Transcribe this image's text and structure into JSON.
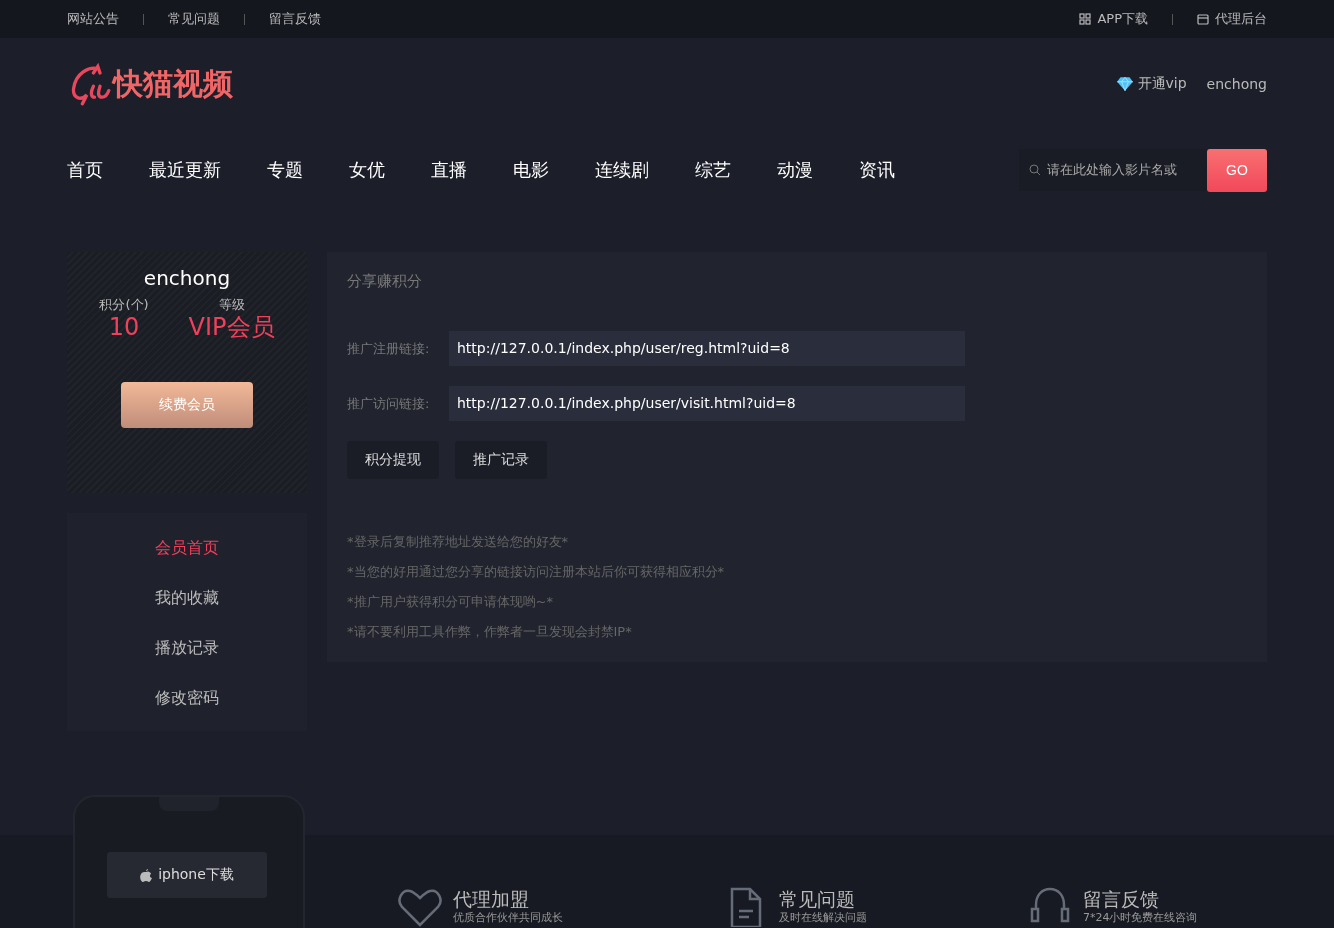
{
  "top_links": [
    "网站公告",
    "常见问题",
    "留言反馈"
  ],
  "top_right": [
    {
      "kind": "app",
      "label": "APP下载"
    },
    {
      "kind": "agent",
      "label": "代理后台"
    }
  ],
  "logo": {
    "text": "快猫视频"
  },
  "user_links": [
    {
      "kind": "vip",
      "label": "开通vip"
    },
    {
      "kind": "user",
      "label": "enchong"
    }
  ],
  "nav": [
    {
      "label": "首页",
      "selected": false
    },
    {
      "label": "最近更新",
      "selected": false
    },
    {
      "label": "专题",
      "selected": false
    },
    {
      "label": "女优",
      "selected": false
    },
    {
      "label": "直播",
      "selected": false
    },
    {
      "label": "电影",
      "selected": false
    },
    {
      "label": "连续剧",
      "selected": false
    },
    {
      "label": "综艺",
      "selected": false
    },
    {
      "label": "动漫",
      "selected": false
    },
    {
      "label": "资讯",
      "selected": false
    }
  ],
  "search": {
    "placeholder": "请在此处输入影片名或",
    "button": "GO"
  },
  "profile": {
    "username": "enchong",
    "points_label": "积分(个)",
    "points": "10",
    "level_label": "等级",
    "level": "VIP会员",
    "renew_button": "续费会员"
  },
  "menu": [
    {
      "label": "会员首页",
      "selected": true
    },
    {
      "label": "我的收藏",
      "selected": false
    },
    {
      "label": "播放记录",
      "selected": false
    },
    {
      "label": "修改密码",
      "selected": false
    }
  ],
  "share": {
    "title": "分享赚积分",
    "links": [
      {
        "label": "推广注册链接:",
        "value": "http://127.0.0.1/index.php/user/reg.html?uid=8"
      },
      {
        "label": "推广访问链接:",
        "value": "http://127.0.0.1/index.php/user/visit.html?uid=8"
      }
    ],
    "buttons": [
      "积分提现",
      "推广记录"
    ],
    "notes": [
      "*登录后复制推荐地址发送给您的好友*",
      "*当您的好用通过您分享的链接访问注册本站后你可获得相应积分*",
      "*推广用户获得积分可申请体现哟~*",
      "*请不要利用工具作弊，作弊者一旦发现会封禁IP*"
    ]
  },
  "phone": {
    "button": "iphone下载"
  },
  "footer": [
    {
      "kind": "heart",
      "title": "代理加盟",
      "subtitle": "优质合作伙伴共同成长"
    },
    {
      "kind": "doc",
      "title": "常见问题",
      "subtitle": "及时在线解决问题"
    },
    {
      "kind": "headset",
      "title": "留言反馈",
      "subtitle": "7*24小时免费在线咨询"
    }
  ]
}
